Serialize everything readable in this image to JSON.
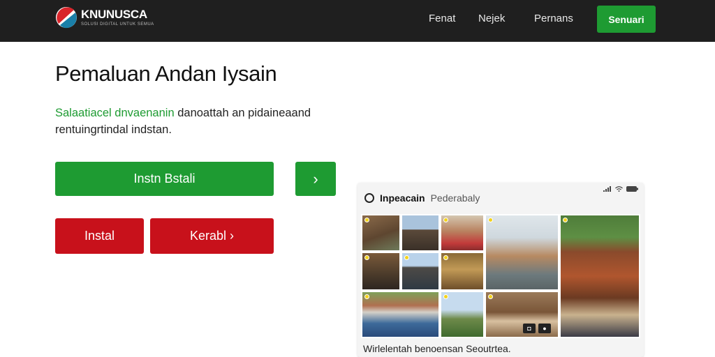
{
  "header": {
    "brand": "KNUNUSCA",
    "brand_tagline": "SOLUSI DIGITAL UNTUK SEMUA",
    "nav": [
      {
        "label": "Fenat"
      },
      {
        "label": "Nejek"
      },
      {
        "label": "Pernans"
      }
    ],
    "cta_label": "Senuari"
  },
  "main": {
    "title": "Pemaluan Andan Iysain",
    "desc_highlight": "Salaatiacel dnvaenanin",
    "desc_rest": " danoattah an pidaineaand rentuingrtindal indstan.",
    "buttons": {
      "install_main": "Instn Bstali",
      "arrow": "›",
      "instal": "Instal",
      "kerabl": "Kerabl ›"
    }
  },
  "preview": {
    "app_name": "Inpeacain",
    "app_subtitle": "Pederabaly",
    "caption": "Wirlelentah benoensan Seoutrtea.",
    "status_icons": [
      "signal-icon",
      "wifi-icon",
      "battery-icon"
    ]
  },
  "colors": {
    "header_bg": "#1f1f1f",
    "green": "#1e9b32",
    "red": "#c8111b"
  }
}
